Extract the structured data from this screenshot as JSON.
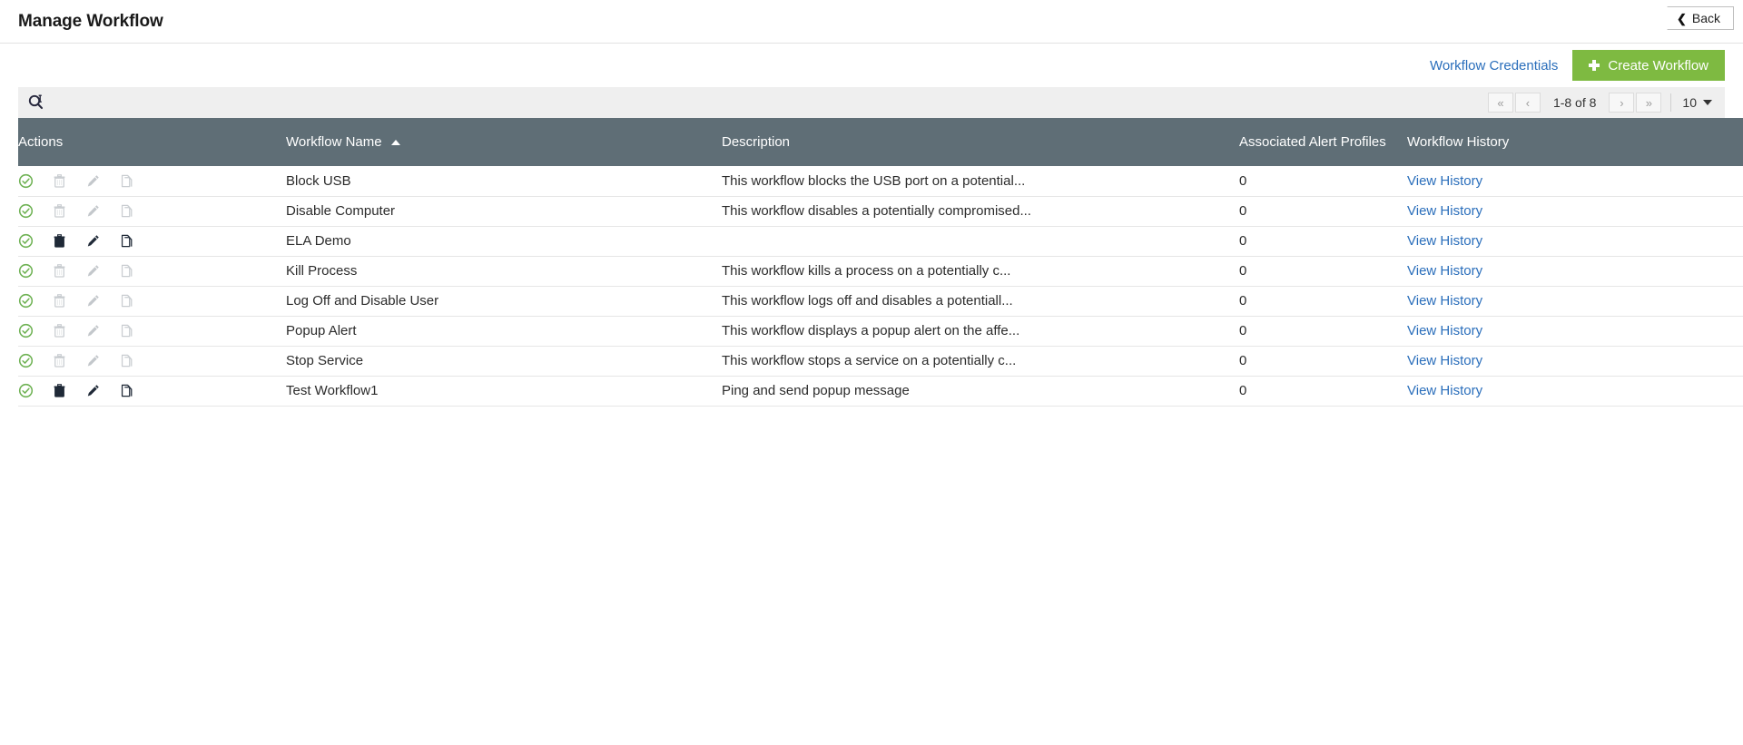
{
  "header": {
    "title": "Manage Workflow",
    "back_label": "Back",
    "back_icon": "chevron-left-icon"
  },
  "action_bar": {
    "credentials_label": "Workflow Credentials",
    "create_label": "Create Workflow",
    "create_icon": "plus-icon",
    "create_color": "#7eba41"
  },
  "toolbar": {
    "search_icon": "search-icon",
    "search_value": "",
    "search_placeholder": "",
    "pager": {
      "first_label": "«",
      "prev_label": "‹",
      "range_label": "1-8 of 8",
      "next_label": "›",
      "last_label": "»",
      "page_size": "10"
    }
  },
  "table": {
    "header_color": "#5f6e76",
    "link_color": "#2a6ebb",
    "columns": [
      {
        "key": "actions",
        "label": "Actions"
      },
      {
        "key": "name",
        "label": "Workflow Name",
        "sort": "asc"
      },
      {
        "key": "desc",
        "label": "Description"
      },
      {
        "key": "profiles",
        "label": "Associated Alert Profiles"
      },
      {
        "key": "history",
        "label": "Workflow History"
      }
    ],
    "action_icons": [
      "check-circle-icon",
      "trash-icon",
      "pencil-icon",
      "copy-icon"
    ],
    "history_link_label": "View History",
    "rows": [
      {
        "name": "Block USB",
        "desc": "This workflow blocks the USB port on a potential...",
        "profiles": "0",
        "history": "View History",
        "enabled_actions": false
      },
      {
        "name": "Disable Computer",
        "desc": "This workflow disables a potentially compromised...",
        "profiles": "0",
        "history": "View History",
        "enabled_actions": false
      },
      {
        "name": "ELA Demo",
        "desc": "",
        "profiles": "0",
        "history": "View History",
        "enabled_actions": true
      },
      {
        "name": "Kill Process",
        "desc": "This workflow kills a process on a potentially c...",
        "profiles": "0",
        "history": "View History",
        "enabled_actions": false
      },
      {
        "name": "Log Off and Disable User",
        "desc": "This workflow logs off and disables a potentiall...",
        "profiles": "0",
        "history": "View History",
        "enabled_actions": false
      },
      {
        "name": "Popup Alert",
        "desc": "This workflow displays a popup alert on the affe...",
        "profiles": "0",
        "history": "View History",
        "enabled_actions": false
      },
      {
        "name": "Stop Service",
        "desc": "This workflow stops a service on a potentially c...",
        "profiles": "0",
        "history": "View History",
        "enabled_actions": false
      },
      {
        "name": "Test Workflow1",
        "desc": "Ping and send popup message",
        "profiles": "0",
        "history": "View History",
        "enabled_actions": true
      }
    ]
  }
}
